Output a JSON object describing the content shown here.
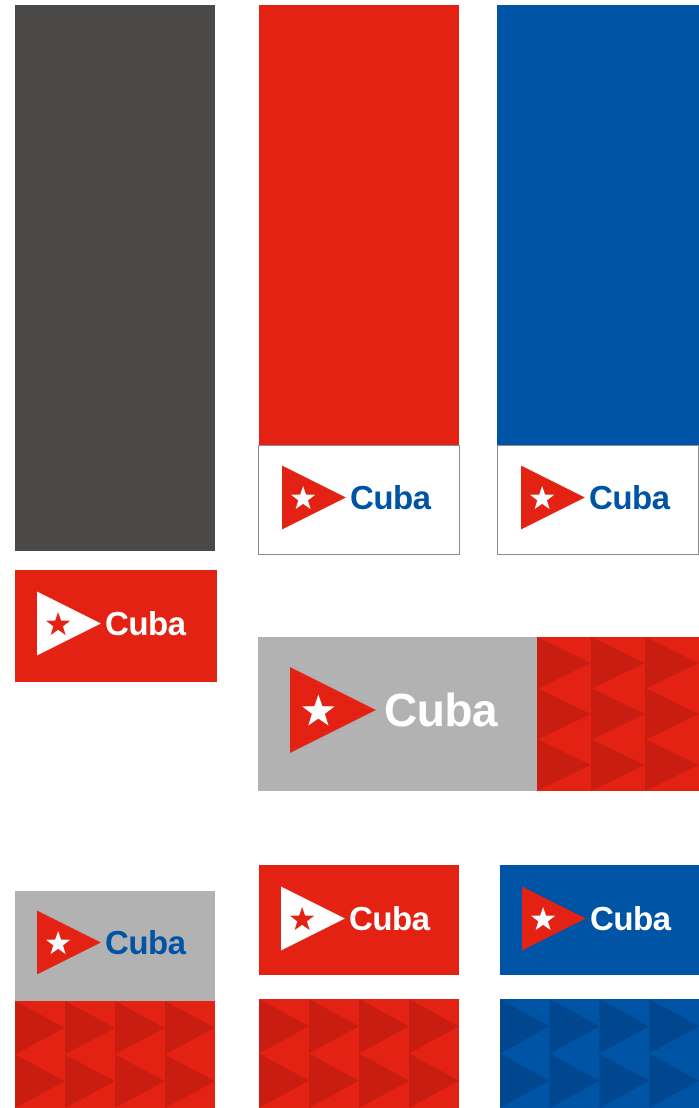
{
  "brand": {
    "wordmark": "Cuba",
    "colors": {
      "red": "#e32213",
      "red_dark": "#c81d10",
      "blue": "#0054a6",
      "blue_dark": "#00478f",
      "gray_dark": "#4a4948",
      "gray_light": "#b2b2b2",
      "white": "#ffffff"
    },
    "icons": [
      "flag-triangle-star-icon"
    ]
  }
}
